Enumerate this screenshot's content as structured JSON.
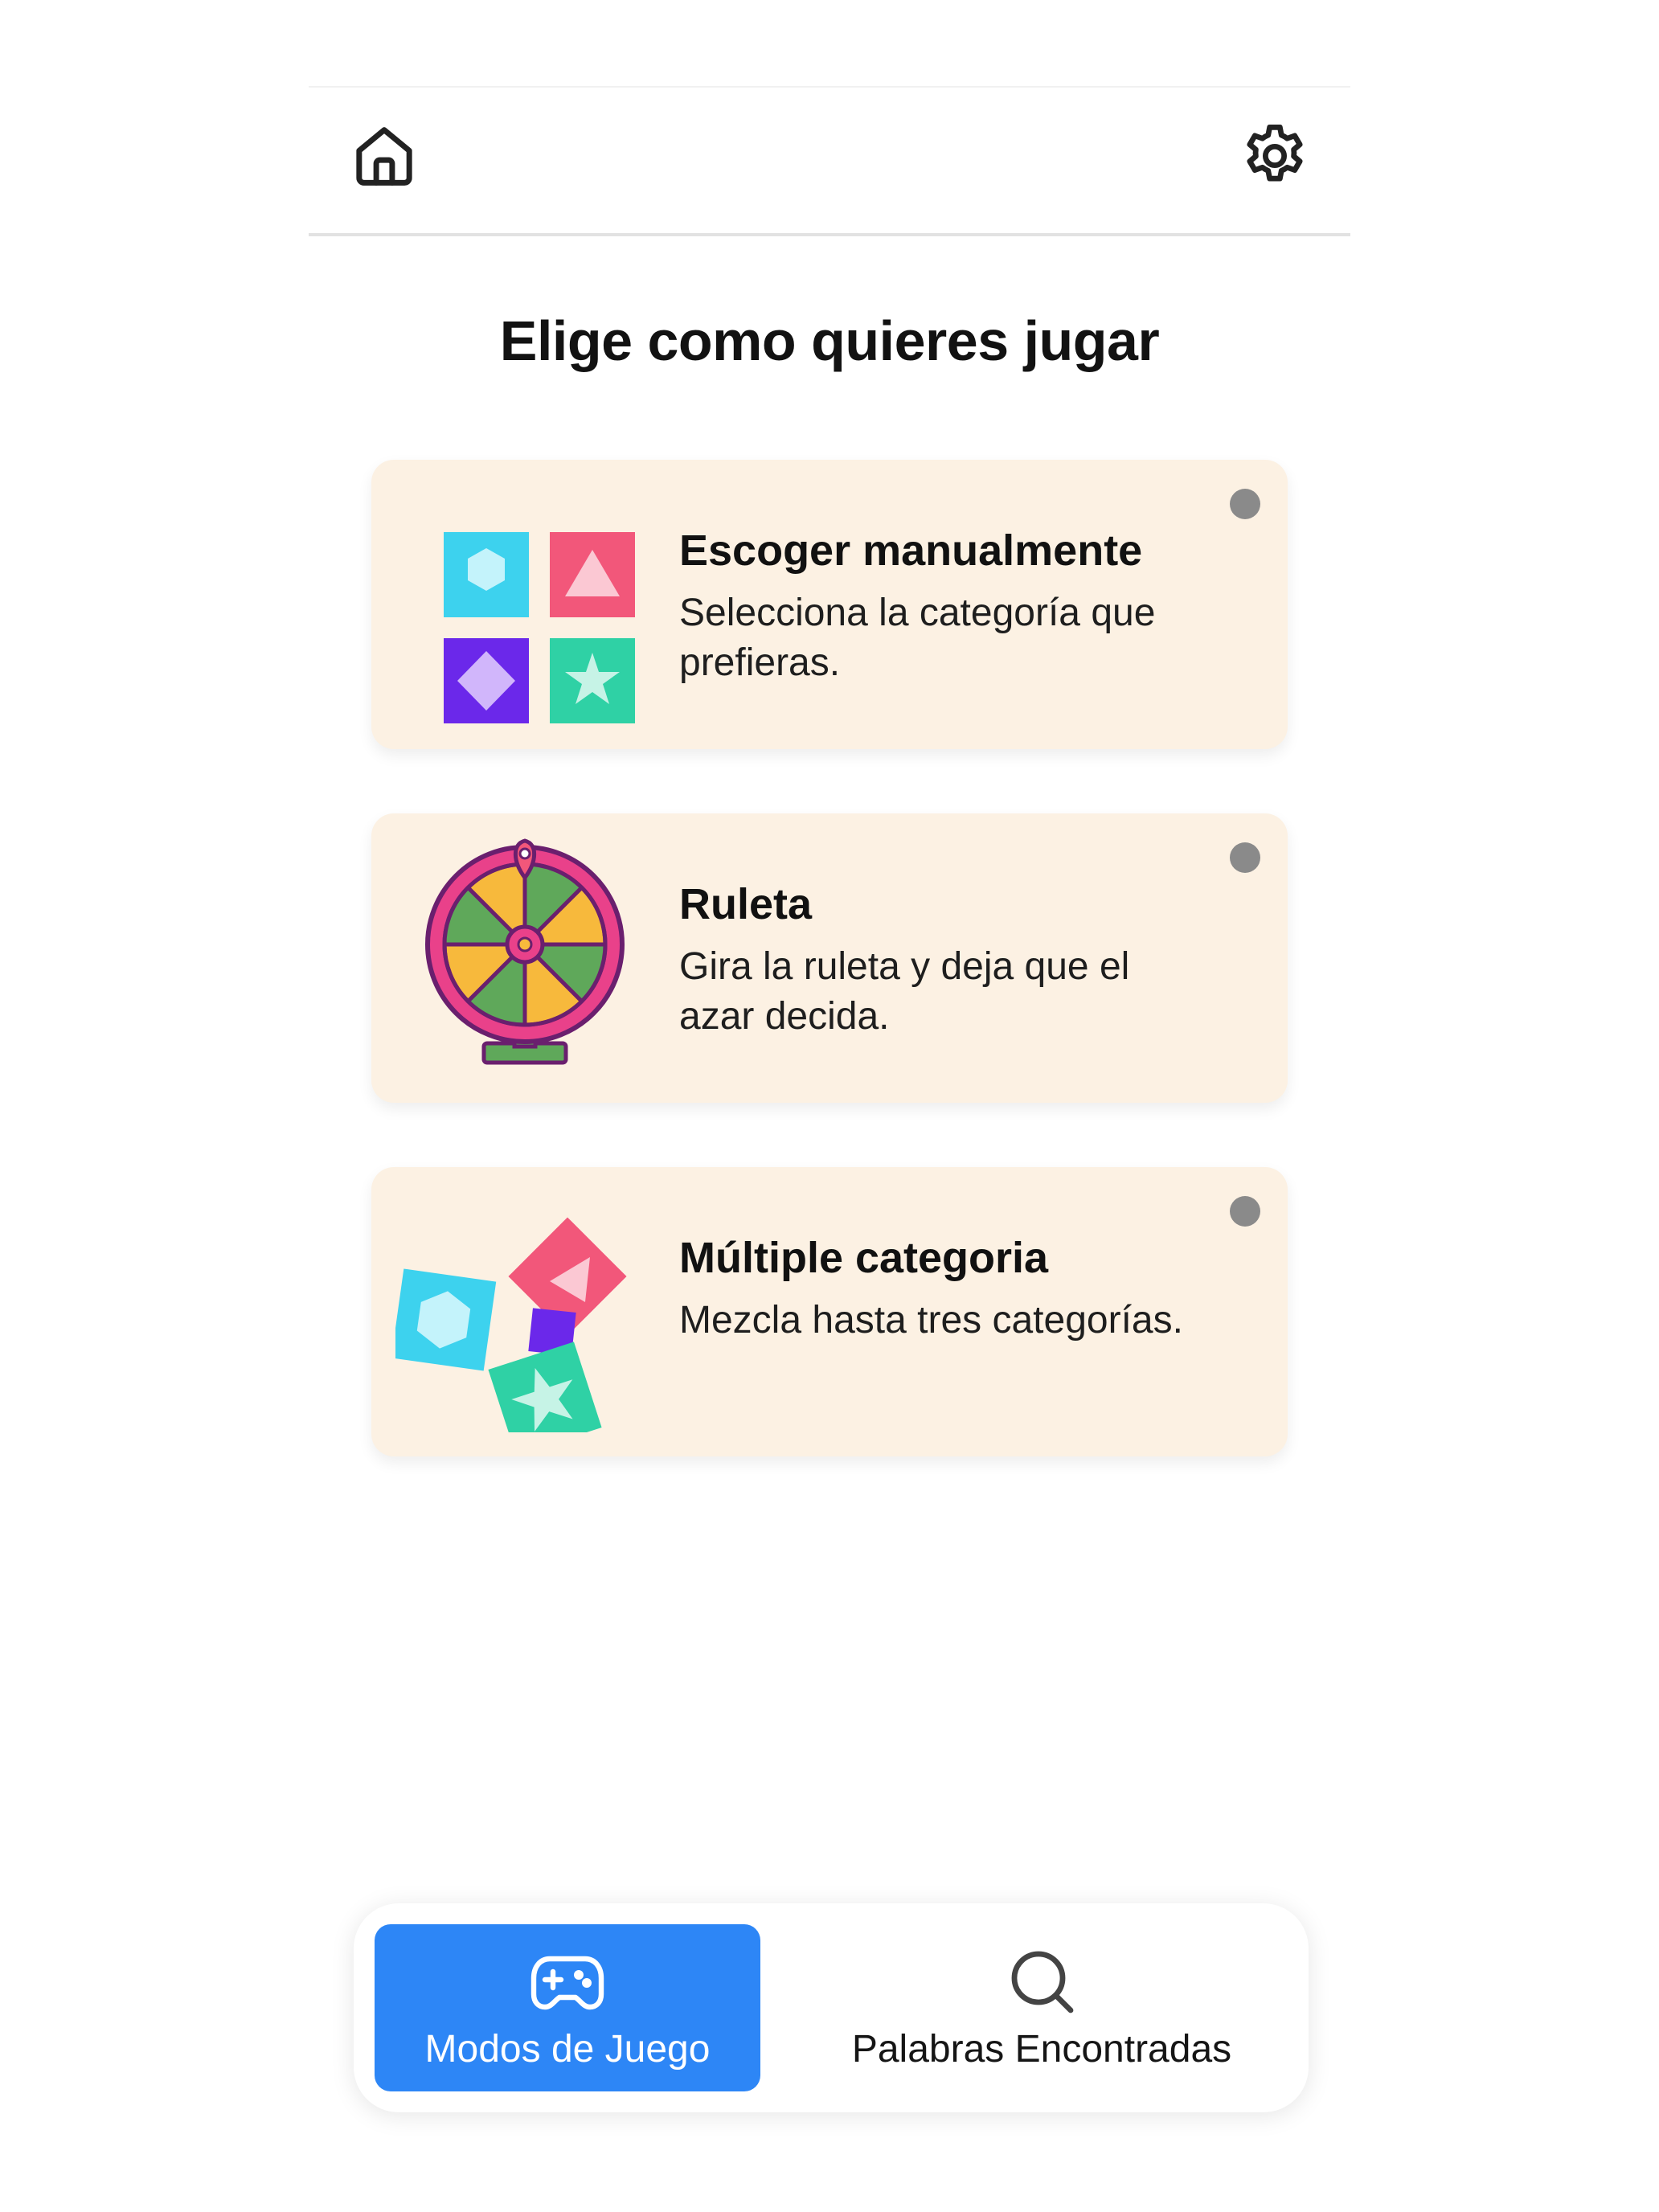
{
  "header": {
    "home_icon": "home-icon",
    "settings_icon": "gear-icon"
  },
  "page": {
    "title": "Elige como quieres jugar"
  },
  "modes": [
    {
      "title": "Escoger manualmente",
      "description": "Selecciona la categoría que prefieras.",
      "icon": "category-grid-icon"
    },
    {
      "title": "Ruleta",
      "description": "Gira la ruleta y deja que el azar decida.",
      "icon": "roulette-wheel-icon"
    },
    {
      "title": "Múltiple categoria",
      "description": "Mezcla hasta tres categorías.",
      "icon": "mixed-categories-icon"
    }
  ],
  "tabs": [
    {
      "label": "Modos de Juego",
      "icon": "gamepad-icon",
      "active": true
    },
    {
      "label": "Palabras Encontradas",
      "icon": "search-icon",
      "active": false
    }
  ],
  "colors": {
    "card_background": "#fcf1e3",
    "accent_blue": "#2d86f6",
    "cyan": "#3dd2ee",
    "pink": "#f2577a",
    "purple": "#6b28ea",
    "teal": "#2fd1a5",
    "dot_gray": "#8a8a8a"
  }
}
